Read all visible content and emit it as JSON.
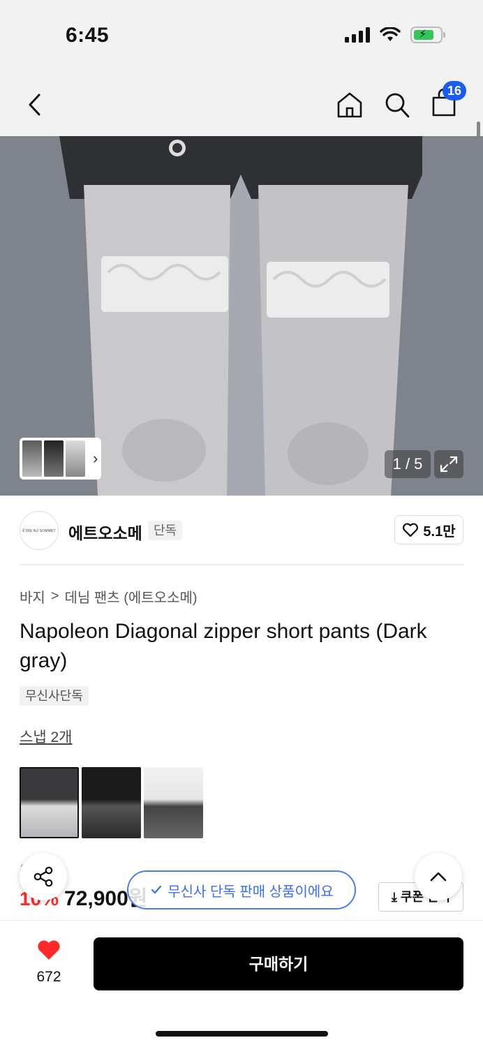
{
  "status_bar": {
    "time": "6:45"
  },
  "header": {
    "cart_count": "16"
  },
  "gallery": {
    "counter": "1 / 5"
  },
  "brand": {
    "logo_text": "ÊTRE AU SOMMET",
    "name": "에트오소메",
    "tag": "단독",
    "likes": "5.1만"
  },
  "breadcrumb": {
    "category": "바지",
    "separator": ">",
    "subcategory": "데님 팬츠 (에트오소메)"
  },
  "product": {
    "title": "Napoleon Diagonal zipper short pants (Dark gray)",
    "exclusive_tag": "무신사단독",
    "snap_link": "스냅 2개",
    "original_price": "원",
    "discount": "10%",
    "price": "72,900원",
    "coupon": "쿠폰 받기"
  },
  "toast": {
    "text": "무신사 단독 판매 상품이에요"
  },
  "bottom_bar": {
    "wish_count": "672",
    "buy_label": "구매하기"
  },
  "colors": {
    "accent_blue": "#1a5cf0",
    "discount_red": "#ff2a2a",
    "wish_red": "#ff2a2a",
    "buy_black": "#000000"
  }
}
